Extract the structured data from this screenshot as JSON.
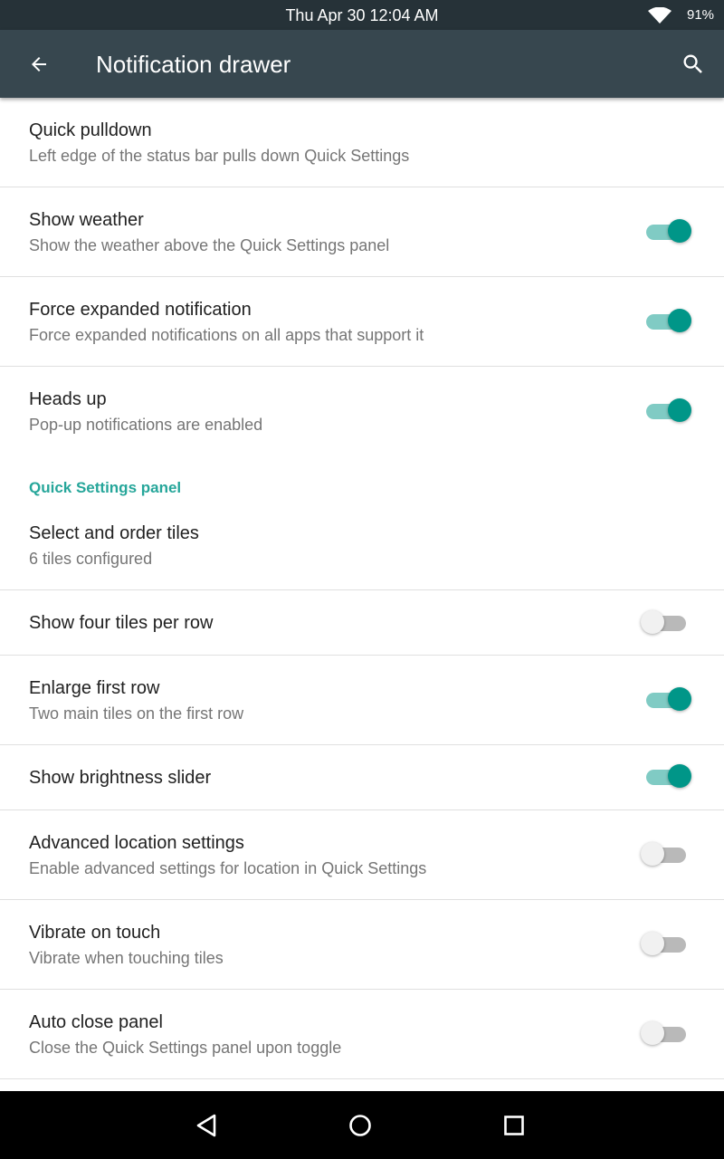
{
  "status_bar": {
    "time": "Thu Apr 30 12:04 AM",
    "battery": "91%",
    "wifi_icon": "wifi-icon"
  },
  "app_bar": {
    "title": "Notification drawer",
    "back_icon": "arrow-back-icon",
    "search_icon": "search-icon",
    "background": "#37474f"
  },
  "accent_color": "#009688",
  "preferences": [
    {
      "title": "Quick pulldown",
      "summary": "Left edge of the status bar pulls down Quick Settings"
    },
    {
      "title": "Show weather",
      "summary": "Show the weather above the Quick Settings panel",
      "checked": true
    },
    {
      "title": "Force expanded notification",
      "summary": "Force expanded notifications on all apps that support it",
      "checked": true
    },
    {
      "title": "Heads up",
      "summary": "Pop-up notifications are enabled",
      "checked": true
    }
  ],
  "quick_settings_section": {
    "header": "Quick Settings panel",
    "items": [
      {
        "title": "Select and order tiles",
        "summary": "6 tiles configured"
      },
      {
        "title": "Show four tiles per row",
        "checked": false
      },
      {
        "title": "Enlarge first row",
        "summary": "Two main tiles on the first row",
        "checked": true
      },
      {
        "title": "Show brightness slider",
        "checked": true
      },
      {
        "title": "Advanced location settings",
        "summary": "Enable advanced settings for location in Quick Settings",
        "checked": false
      },
      {
        "title": "Vibrate on touch",
        "summary": "Vibrate when touching tiles",
        "checked": false
      },
      {
        "title": "Auto close panel",
        "summary": "Close the Quick Settings panel upon toggle",
        "checked": false
      }
    ]
  },
  "nav_bar": {
    "back_icon": "nav-back-icon",
    "home_icon": "nav-home-icon",
    "recents_icon": "nav-recents-icon"
  }
}
